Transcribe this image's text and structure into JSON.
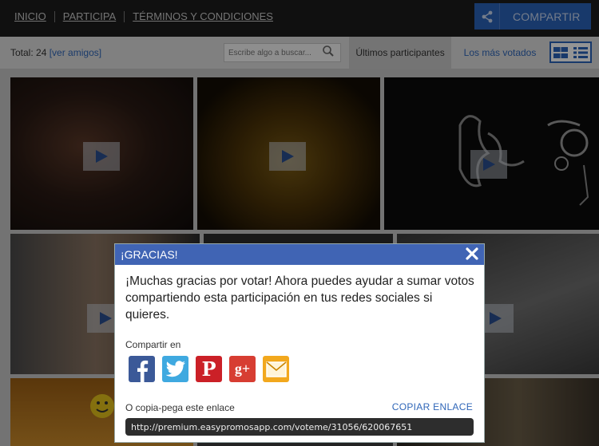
{
  "nav": {
    "items": [
      "INICIO",
      "PARTICIPA",
      "TÉRMINOS Y CONDICIONES"
    ],
    "share_button": "COMPARTIR"
  },
  "toolbar": {
    "total_label": "Total: 24",
    "friends_link": "[ver amigos]",
    "search_placeholder": "Escribe algo a buscar...",
    "tab_latest": "Últimos participantes",
    "tab_most_voted": "Los más votados"
  },
  "modal": {
    "title": "¡GRACIAS!",
    "message": "¡Muchas gracias por votar! Ahora puedes ayudar a sumar votos compartiendo esta participación en tus redes sociales si quieres.",
    "share_in": "Compartir en",
    "social_icons": [
      "facebook-icon",
      "twitter-icon",
      "pinterest-icon",
      "google-plus-icon",
      "email-icon"
    ],
    "copy_label": "O copia-pega este enlace",
    "copy_button": "COPIAR ENLACE",
    "link": "http://premium.easypromosapp.com/voteme/31056/620067651"
  },
  "colors": {
    "accent": "#2a62b9",
    "modal_header": "#4064b4",
    "facebook": "#3b5998",
    "twitter": "#3fa9e0",
    "pinterest": "#cb2027",
    "google_plus": "#d73d32",
    "email": "#f2a81d"
  }
}
